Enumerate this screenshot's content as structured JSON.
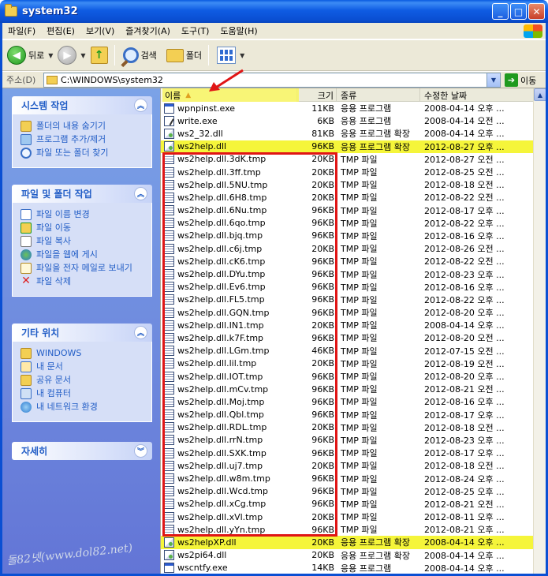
{
  "window": {
    "title": "system32"
  },
  "menu": [
    "파일(F)",
    "편집(E)",
    "보기(V)",
    "즐겨찾기(A)",
    "도구(T)",
    "도움말(H)"
  ],
  "toolbar": {
    "back_label": "뒤로",
    "search_label": "검색",
    "folders_label": "폴더"
  },
  "address": {
    "label": "주소(D)",
    "value": "C:\\WINDOWS\\system32",
    "go_label": "이동"
  },
  "taskpane": {
    "system_tasks": {
      "title": "시스템 작업",
      "items": [
        "폴더의 내용 숨기기",
        "프로그램 추가/제거",
        "파일 또는 폴더 찾기"
      ]
    },
    "file_tasks": {
      "title": "파일 및 폴더 작업",
      "items": [
        "파일 이름 변경",
        "파일 이동",
        "파일 복사",
        "파일을 웹에 게시",
        "파일을 전자 메일로 보내기",
        "파일 삭제"
      ]
    },
    "other_places": {
      "title": "기타 위치",
      "items": [
        "WINDOWS",
        "내 문서",
        "공유 문서",
        "내 컴퓨터",
        "내 네트워크 환경"
      ]
    },
    "details": {
      "title": "자세히"
    }
  },
  "watermark": "돌82넷(www.dol82.net)",
  "columns": {
    "name": "이름",
    "size": "크기",
    "type": "종류",
    "date": "수정한 날짜"
  },
  "files": [
    {
      "name": "wpnpinst.exe",
      "size": "11KB",
      "type": "응용 프로그램",
      "date": "2008-04-14 오후 ...",
      "icon": "exe",
      "hl": false
    },
    {
      "name": "write.exe",
      "size": "6KB",
      "type": "응용 프로그램",
      "date": "2008-04-14 오전 ...",
      "icon": "script",
      "hl": false
    },
    {
      "name": "ws2_32.dll",
      "size": "81KB",
      "type": "응용 프로그램 확장",
      "date": "2008-04-14 오후 ...",
      "icon": "dll",
      "hl": false
    },
    {
      "name": "ws2help.dll",
      "size": "96KB",
      "type": "응용 프로그램 확장",
      "date": "2012-08-27 오후 ...",
      "icon": "dll",
      "hl": true
    },
    {
      "name": "ws2help.dll.3dK.tmp",
      "size": "20KB",
      "type": "TMP 파일",
      "date": "2012-08-27 오전 ...",
      "icon": "tmp",
      "hl": false
    },
    {
      "name": "ws2help.dll.3ff.tmp",
      "size": "20KB",
      "type": "TMP 파일",
      "date": "2012-08-25 오전 ...",
      "icon": "tmp",
      "hl": false
    },
    {
      "name": "ws2help.dll.5NU.tmp",
      "size": "20KB",
      "type": "TMP 파일",
      "date": "2012-08-18 오전 ...",
      "icon": "tmp",
      "hl": false
    },
    {
      "name": "ws2help.dll.6H8.tmp",
      "size": "20KB",
      "type": "TMP 파일",
      "date": "2012-08-22 오전 ...",
      "icon": "tmp",
      "hl": false
    },
    {
      "name": "ws2help.dll.6Nu.tmp",
      "size": "96KB",
      "type": "TMP 파일",
      "date": "2012-08-17 오후 ...",
      "icon": "tmp",
      "hl": false
    },
    {
      "name": "ws2help.dll.6qo.tmp",
      "size": "96KB",
      "type": "TMP 파일",
      "date": "2012-08-22 오후 ...",
      "icon": "tmp",
      "hl": false
    },
    {
      "name": "ws2help.dll.bjq.tmp",
      "size": "96KB",
      "type": "TMP 파일",
      "date": "2012-08-16 오후 ...",
      "icon": "tmp",
      "hl": false
    },
    {
      "name": "ws2help.dll.c6j.tmp",
      "size": "20KB",
      "type": "TMP 파일",
      "date": "2012-08-26 오전 ...",
      "icon": "tmp",
      "hl": false
    },
    {
      "name": "ws2help.dll.cK6.tmp",
      "size": "96KB",
      "type": "TMP 파일",
      "date": "2012-08-22 오전 ...",
      "icon": "tmp",
      "hl": false
    },
    {
      "name": "ws2help.dll.DYu.tmp",
      "size": "96KB",
      "type": "TMP 파일",
      "date": "2012-08-23 오후 ...",
      "icon": "tmp",
      "hl": false
    },
    {
      "name": "ws2help.dll.Ev6.tmp",
      "size": "96KB",
      "type": "TMP 파일",
      "date": "2012-08-16 오후 ...",
      "icon": "tmp",
      "hl": false
    },
    {
      "name": "ws2help.dll.FL5.tmp",
      "size": "96KB",
      "type": "TMP 파일",
      "date": "2012-08-22 오후 ...",
      "icon": "tmp",
      "hl": false
    },
    {
      "name": "ws2help.dll.GQN.tmp",
      "size": "96KB",
      "type": "TMP 파일",
      "date": "2012-08-20 오후 ...",
      "icon": "tmp",
      "hl": false
    },
    {
      "name": "ws2help.dll.IN1.tmp",
      "size": "20KB",
      "type": "TMP 파일",
      "date": "2008-04-14 오후 ...",
      "icon": "tmp",
      "hl": false
    },
    {
      "name": "ws2help.dll.k7F.tmp",
      "size": "96KB",
      "type": "TMP 파일",
      "date": "2012-08-20 오전 ...",
      "icon": "tmp",
      "hl": false
    },
    {
      "name": "ws2help.dll.LGm.tmp",
      "size": "46KB",
      "type": "TMP 파일",
      "date": "2012-07-15 오전 ...",
      "icon": "tmp",
      "hl": false
    },
    {
      "name": "ws2help.dll.lil.tmp",
      "size": "20KB",
      "type": "TMP 파일",
      "date": "2012-08-19 오전 ...",
      "icon": "tmp",
      "hl": false
    },
    {
      "name": "ws2help.dll.IOT.tmp",
      "size": "96KB",
      "type": "TMP 파일",
      "date": "2012-08-20 오후 ...",
      "icon": "tmp",
      "hl": false
    },
    {
      "name": "ws2help.dll.mCv.tmp",
      "size": "96KB",
      "type": "TMP 파일",
      "date": "2012-08-21 오전 ...",
      "icon": "tmp",
      "hl": false
    },
    {
      "name": "ws2help.dll.Moj.tmp",
      "size": "96KB",
      "type": "TMP 파일",
      "date": "2012-08-16 오후 ...",
      "icon": "tmp",
      "hl": false
    },
    {
      "name": "ws2help.dll.Qbl.tmp",
      "size": "96KB",
      "type": "TMP 파일",
      "date": "2012-08-17 오후 ...",
      "icon": "tmp",
      "hl": false
    },
    {
      "name": "ws2help.dll.RDL.tmp",
      "size": "20KB",
      "type": "TMP 파일",
      "date": "2012-08-18 오전 ...",
      "icon": "tmp",
      "hl": false
    },
    {
      "name": "ws2help.dll.rrN.tmp",
      "size": "96KB",
      "type": "TMP 파일",
      "date": "2012-08-23 오후 ...",
      "icon": "tmp",
      "hl": false
    },
    {
      "name": "ws2help.dll.SXK.tmp",
      "size": "96KB",
      "type": "TMP 파일",
      "date": "2012-08-17 오후 ...",
      "icon": "tmp",
      "hl": false
    },
    {
      "name": "ws2help.dll.uj7.tmp",
      "size": "20KB",
      "type": "TMP 파일",
      "date": "2012-08-18 오전 ...",
      "icon": "tmp",
      "hl": false
    },
    {
      "name": "ws2help.dll.w8m.tmp",
      "size": "96KB",
      "type": "TMP 파일",
      "date": "2012-08-24 오후 ...",
      "icon": "tmp",
      "hl": false
    },
    {
      "name": "ws2help.dll.Wcd.tmp",
      "size": "96KB",
      "type": "TMP 파일",
      "date": "2012-08-25 오후 ...",
      "icon": "tmp",
      "hl": false
    },
    {
      "name": "ws2help.dll.xCg.tmp",
      "size": "96KB",
      "type": "TMP 파일",
      "date": "2012-08-21 오전 ...",
      "icon": "tmp",
      "hl": false
    },
    {
      "name": "ws2help.dll.xVl.tmp",
      "size": "20KB",
      "type": "TMP 파일",
      "date": "2012-08-11 오후 ...",
      "icon": "tmp",
      "hl": false
    },
    {
      "name": "ws2help.dll.yYn.tmp",
      "size": "96KB",
      "type": "TMP 파일",
      "date": "2012-08-21 오후 ...",
      "icon": "tmp",
      "hl": false
    },
    {
      "name": "ws2helpXP.dll",
      "size": "20KB",
      "type": "응용 프로그램 확장",
      "date": "2008-04-14 오후 ...",
      "icon": "dll",
      "hl": true
    },
    {
      "name": "ws2pi64.dll",
      "size": "20KB",
      "type": "응용 프로그램 확장",
      "date": "2008-04-14 오후 ...",
      "icon": "dll",
      "hl": false
    },
    {
      "name": "wscntfy.exe",
      "size": "14KB",
      "type": "응용 프로그램",
      "date": "2008-04-14 오후 ...",
      "icon": "exe",
      "hl": false
    }
  ],
  "colors": {
    "highlight": "#f5f53a",
    "annotation": "#e01515",
    "titlebar": "#0a4fd3"
  }
}
